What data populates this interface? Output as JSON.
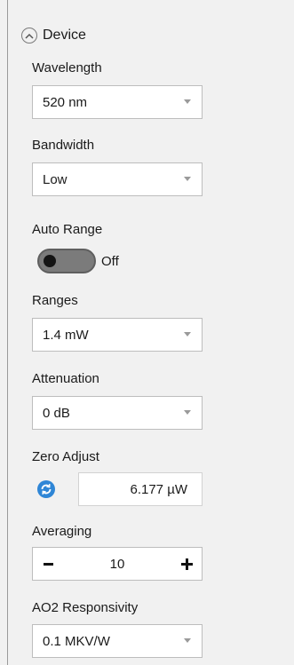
{
  "section": {
    "title": "Device",
    "collapse_icon": "chevron-up-icon"
  },
  "wavelength": {
    "label": "Wavelength",
    "value": "520 nm"
  },
  "bandwidth": {
    "label": "Bandwidth",
    "value": "Low"
  },
  "auto_range": {
    "label": "Auto Range",
    "state": "Off"
  },
  "ranges": {
    "label": "Ranges",
    "value": "1.4 mW"
  },
  "attenuation": {
    "label": "Attenuation",
    "value": "0 dB"
  },
  "zero_adjust": {
    "label": "Zero Adjust",
    "value": "6.177 µW",
    "icon": "refresh-icon",
    "icon_color": "#2f86d6"
  },
  "averaging": {
    "label": "Averaging",
    "value": "10",
    "minus": "-",
    "plus": "+"
  },
  "ao2_responsivity": {
    "label": "AO2 Responsivity",
    "value": "0.1 MKV/W"
  }
}
